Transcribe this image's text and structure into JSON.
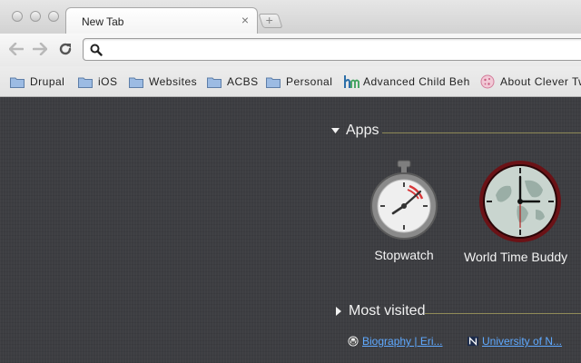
{
  "browser": {
    "tab": {
      "title": "New Tab",
      "close_glyph": "×"
    },
    "newtab_glyph": "+",
    "omnibox": {
      "value": "",
      "placeholder": ""
    }
  },
  "bookmarks": [
    {
      "label": "Drupal",
      "icon": "folder-icon"
    },
    {
      "label": "iOS",
      "icon": "folder-icon"
    },
    {
      "label": "Websites",
      "icon": "folder-icon"
    },
    {
      "label": "ACBS",
      "icon": "folder-icon"
    },
    {
      "label": "Personal",
      "icon": "folder-icon"
    },
    {
      "label": "Advanced Child Beha",
      "icon": "hm-logo-icon"
    },
    {
      "label": "About Clever Tw",
      "icon": "cookie-icon"
    }
  ],
  "ntp": {
    "apps_header": "Apps",
    "apps": [
      {
        "label": "Stopwatch",
        "icon": "stopwatch-icon"
      },
      {
        "label": "World Time Buddy",
        "icon": "world-clock-icon"
      }
    ],
    "most_visited_header": "Most visited",
    "most_visited": [
      {
        "label": "Biography | Eri...",
        "icon": "wordpress-icon"
      },
      {
        "label": "University of N...",
        "icon": "n-logo-icon"
      }
    ]
  },
  "colors": {
    "ntp_background": "#3d3e42",
    "section_line": "#8f8a58",
    "link": "#5fa9ff",
    "folder": "#8fb3e0"
  }
}
